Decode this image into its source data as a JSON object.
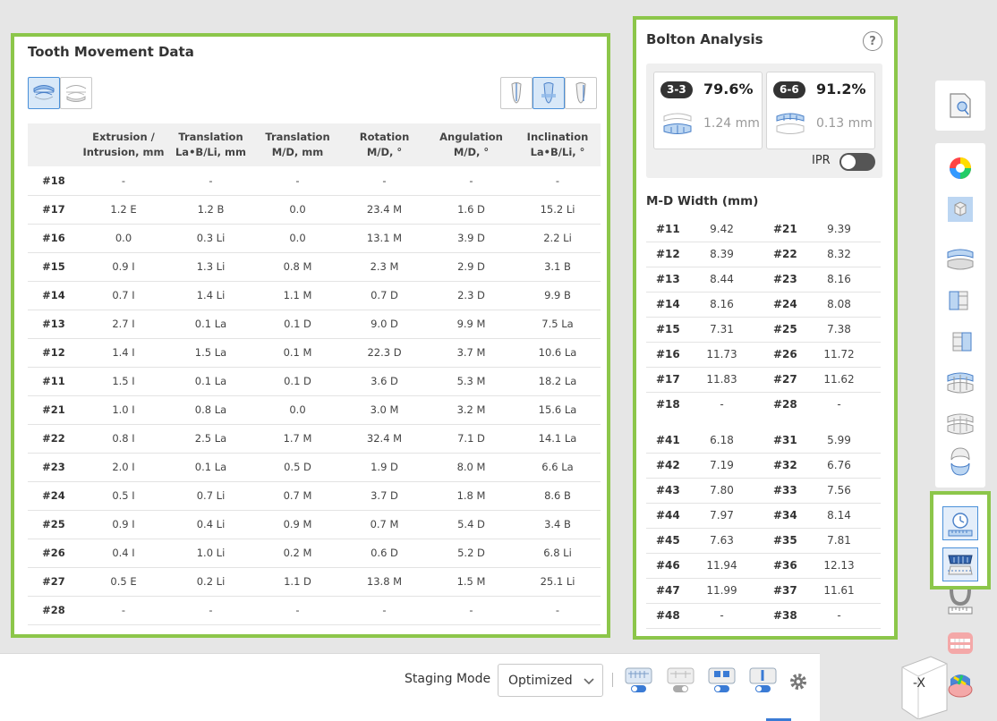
{
  "tooth_movement": {
    "title": "Tooth Movement Data",
    "headers": [
      "",
      "Extrusion /\nIntrusion, mm",
      "Translation\nLa•B/Li, mm",
      "Translation\nM/D, mm",
      "Rotation\nM/D, °",
      "Angulation\nM/D, °",
      "Inclination\nLa•B/Li, °"
    ],
    "rows": [
      [
        "#18",
        "-",
        "-",
        "-",
        "-",
        "-",
        "-"
      ],
      [
        "#17",
        "1.2 E",
        "1.2 B",
        "0.0",
        "23.4 M",
        "1.6 D",
        "15.2 Li"
      ],
      [
        "#16",
        "0.0",
        "0.3 Li",
        "0.0",
        "13.1 M",
        "3.9 D",
        "2.2 Li"
      ],
      [
        "#15",
        "0.9 I",
        "1.3 Li",
        "0.8 M",
        "2.3 M",
        "2.9 D",
        "3.1 B"
      ],
      [
        "#14",
        "0.7 I",
        "1.4 Li",
        "1.1 M",
        "0.7 D",
        "2.3 D",
        "9.9 B"
      ],
      [
        "#13",
        "2.7 I",
        "0.1 La",
        "0.1 D",
        "9.0 D",
        "9.9 M",
        "7.5 La"
      ],
      [
        "#12",
        "1.4 I",
        "1.5 La",
        "0.1 M",
        "22.3 D",
        "3.7 M",
        "10.6 La"
      ],
      [
        "#11",
        "1.5 I",
        "0.1 La",
        "0.1 D",
        "3.6 D",
        "5.3 M",
        "18.2 La"
      ],
      [
        "#21",
        "1.0 I",
        "0.8 La",
        "0.0",
        "3.0 M",
        "3.2 M",
        "15.6 La"
      ],
      [
        "#22",
        "0.8 I",
        "2.5 La",
        "1.7 M",
        "32.4 M",
        "7.1 D",
        "14.1 La"
      ],
      [
        "#23",
        "2.0 I",
        "0.1 La",
        "0.5 D",
        "1.9 D",
        "8.0 M",
        "6.6 La"
      ],
      [
        "#24",
        "0.5 I",
        "0.7 Li",
        "0.7 M",
        "3.7 D",
        "1.8 M",
        "8.6 B"
      ],
      [
        "#25",
        "0.9 I",
        "0.4 Li",
        "0.9 M",
        "0.7 M",
        "5.4 D",
        "3.4 B"
      ],
      [
        "#26",
        "0.4 I",
        "1.0 Li",
        "0.2 M",
        "0.6 D",
        "5.2 D",
        "6.8 Li"
      ],
      [
        "#27",
        "0.5 E",
        "0.2 Li",
        "1.1 D",
        "13.8 M",
        "1.5 M",
        "25.1 Li"
      ],
      [
        "#28",
        "-",
        "-",
        "-",
        "-",
        "-",
        "-"
      ]
    ]
  },
  "bolton": {
    "title": "Bolton Analysis",
    "help": "?",
    "anterior": {
      "badge": "3-3",
      "ratio": "79.6%",
      "mm": "1.24 mm"
    },
    "overall": {
      "badge": "6-6",
      "ratio": "91.2%",
      "mm": "0.13 mm"
    },
    "ipr_label": "IPR",
    "ipr_on": false,
    "mdw_title": "M-D Width (mm)",
    "upper": [
      [
        "#11",
        "9.42",
        "#21",
        "9.39"
      ],
      [
        "#12",
        "8.39",
        "#22",
        "8.32"
      ],
      [
        "#13",
        "8.44",
        "#23",
        "8.16"
      ],
      [
        "#14",
        "8.16",
        "#24",
        "8.08"
      ],
      [
        "#15",
        "7.31",
        "#25",
        "7.38"
      ],
      [
        "#16",
        "11.73",
        "#26",
        "11.72"
      ],
      [
        "#17",
        "11.83",
        "#27",
        "11.62"
      ],
      [
        "#18",
        "-",
        "#28",
        "-"
      ]
    ],
    "lower": [
      [
        "#41",
        "6.18",
        "#31",
        "5.99"
      ],
      [
        "#42",
        "7.19",
        "#32",
        "6.76"
      ],
      [
        "#43",
        "7.80",
        "#33",
        "7.56"
      ],
      [
        "#44",
        "7.97",
        "#34",
        "8.14"
      ],
      [
        "#45",
        "7.63",
        "#35",
        "7.81"
      ],
      [
        "#46",
        "11.94",
        "#36",
        "12.13"
      ],
      [
        "#47",
        "11.99",
        "#37",
        "11.61"
      ],
      [
        "#48",
        "-",
        "#38",
        "-"
      ]
    ]
  },
  "bottom_bar": {
    "staging_label": "Staging Mode",
    "staging_value": "Optimized",
    "stage_buttons": [
      "stage-mode-1",
      "stage-mode-2",
      "stage-mode-3",
      "stage-mode-4"
    ]
  },
  "view_cube": {
    "label": "-X"
  },
  "colors": {
    "highlight": "#8cc64a",
    "accent": "#4a90d9",
    "panel": "#ffffff",
    "background": "#e6e6e6"
  }
}
